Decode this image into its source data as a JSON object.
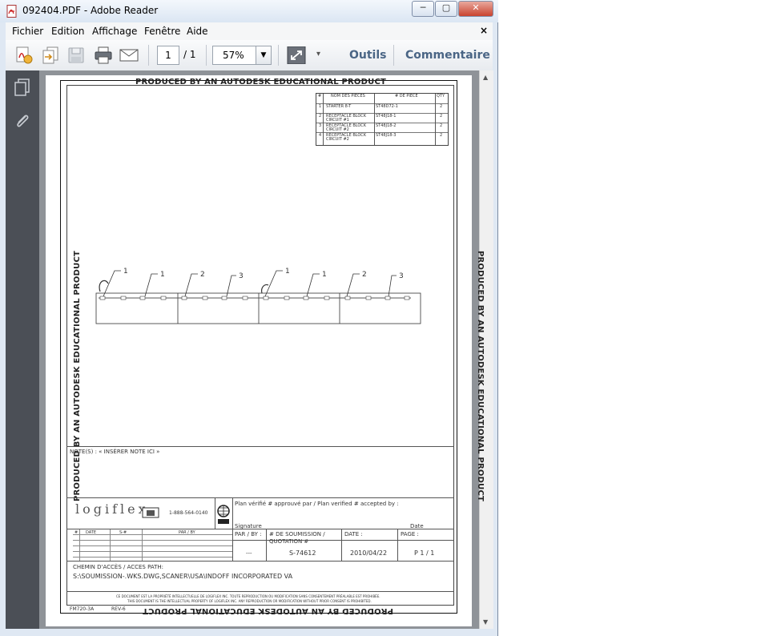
{
  "window": {
    "title": "092404.PDF - Adobe Reader",
    "min_label": "─",
    "max_label": "▢",
    "close_label": "✕"
  },
  "menu": {
    "items": [
      "Fichier",
      "Edition",
      "Affichage",
      "Fenêtre",
      "Aide"
    ],
    "close": "×"
  },
  "toolbar": {
    "current_page": "1",
    "page_total": "/ 1",
    "zoom": "57%",
    "tools_label": "Outils",
    "comment_label": "Commentaire"
  },
  "document": {
    "watermark": "PRODUCED BY AN AUTODESK EDUCATIONAL PRODUCT",
    "parts_table": {
      "headers": [
        "#",
        "NOM DES PIÈCES",
        "# DE PIÈCE",
        "QTY"
      ],
      "rows": [
        {
          "n": "1",
          "name": "STARTER 8-T",
          "part": "ST48D72-1",
          "qty": "2"
        },
        {
          "n": "2",
          "name": "RECEPTACLE BLOCK CIRCUIT #1",
          "part": "ST48J18-1",
          "qty": "2"
        },
        {
          "n": "3",
          "name": "RECEPTACLE BLOCK CIRCUIT #2",
          "part": "ST48J18-2",
          "qty": "2"
        },
        {
          "n": "4",
          "name": "RECEPTACLE BLOCK CIRCUIT #2",
          "part": "ST48J18-3",
          "qty": "2"
        }
      ]
    },
    "callouts": [
      "1",
      "1",
      "2",
      "3",
      "1",
      "1",
      "2",
      "3"
    ],
    "notes": "NOTE(S) : « INSÉRER NOTE ICI »",
    "logo_phone": "1-888-564-0140",
    "approval_text": "Plan vérifié # approuvé par / Plan verified # accepted by :",
    "signature_label": "Signature",
    "date_label": "Date",
    "rev_headers": [
      "#",
      "DATE",
      "S-#",
      "PAR / BY"
    ],
    "par_by_label": "PAR / BY :",
    "par_by_value": "---",
    "quote_label": "# DE SOUMISSION / QUOTATION #",
    "quote_value": "S-74612",
    "date_field_label": "DATE :",
    "date_value": "2010/04/22",
    "page_label": "PAGE :",
    "page_value": "P 1 / 1",
    "path_label": "CHEMIN D'ACCÈS / ACCES PATH:",
    "path_value": "S:\\SOUMISSION-.WKS.DWG,SCANER\\USA\\INDOFF INCORPORATED VA",
    "footer_fr": "CE DOCUMENT EST LA PROPRIÉTÉ INTELLECTUELLE DE LOGIFLEX INC. TOUTE REPRODUCTION OU MODIFICATION SANS CONSENTEMENT PRÉALABLE EST PROHIBÉE.",
    "footer_en": "THIS DOCUMENT IS THE INTELLECTUAL PROPERTY OF LOGIFLEX INC. ANY REPRODUCTION OR MODIFICATION WITHOUT PRIOR CONSENT IS PROHIBITED.",
    "form_code": "FM720-3A",
    "rev_code": "REV-6"
  }
}
